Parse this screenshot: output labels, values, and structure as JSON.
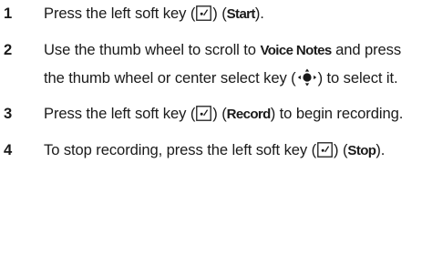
{
  "steps": [
    {
      "number": "1",
      "t1": "Press the left soft key (",
      "t2": ") (",
      "kw": "Start",
      "t3": ")."
    },
    {
      "number": "2",
      "t1": "Use the thumb wheel to scroll to ",
      "kw": "Voice Notes",
      "t2": " and press the thumb wheel or center select key (",
      "t3": ") to select it."
    },
    {
      "number": "3",
      "t1": "Press the left soft key (",
      "t2": ") (",
      "kw": "Record",
      "t3": ") to begin recording."
    },
    {
      "number": "4",
      "t1": "To stop recording, press the left soft key (",
      "t2": ") (",
      "kw": "Stop",
      "t3": ")."
    }
  ],
  "icons": {
    "softkey": "left-soft-key-icon",
    "navkey": "center-select-key-icon"
  }
}
